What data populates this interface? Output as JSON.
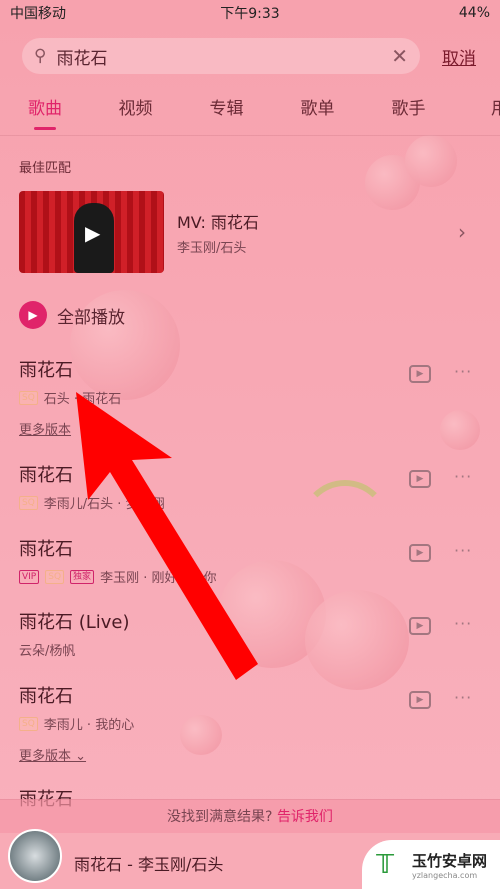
{
  "status": {
    "carrier": "中国移动",
    "time": "下午9:33",
    "battery": "44%"
  },
  "search": {
    "value": "雨花石",
    "cancel": "取消"
  },
  "tabs": [
    "歌曲",
    "视频",
    "专辑",
    "歌单",
    "歌手",
    "用"
  ],
  "best_match": {
    "label": "最佳匹配",
    "title": "MV: 雨花石",
    "subtitle": "李玉刚/石头"
  },
  "play_all": "全部播放",
  "songs": [
    {
      "title": "雨花石",
      "badges": [
        "SQ"
      ],
      "meta": "石头 · 雨花石",
      "more": "更多版本"
    },
    {
      "title": "雨花石",
      "badges": [
        "SQ"
      ],
      "meta": "李雨儿/石头 · 梦飞翔"
    },
    {
      "title": "雨花石",
      "badges": [
        "VIP",
        "SQ",
        "独家"
      ],
      "meta": "李玉刚 · 刚好遇见你"
    },
    {
      "title": "雨花石 (Live)",
      "badges": [],
      "meta": "云朵/杨帆"
    },
    {
      "title": "雨花石",
      "badges": [
        "SQ"
      ],
      "meta": "李雨儿 · 我的心",
      "more": "更多版本 ⌄"
    },
    {
      "title": "雨花石"
    }
  ],
  "feedback": {
    "text": "没找到满意结果?",
    "link": "告诉我们"
  },
  "player": {
    "title": "雨花石 - 李玉刚/石头"
  },
  "watermark": {
    "name": "玉竹安卓网",
    "url": "yzlangecha.com"
  },
  "colors": {
    "accent": "#e0246a",
    "arrow": "#ff0000",
    "background": "#f8a9b5"
  }
}
